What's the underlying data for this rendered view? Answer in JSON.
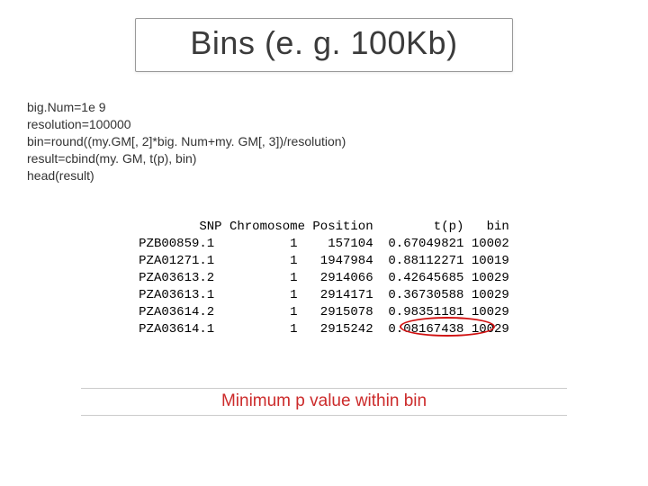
{
  "title": "Bins (e. g. 100Kb)",
  "code": {
    "l1": "big.Num=1e 9",
    "l2": "resolution=100000",
    "l3": "bin=round((my.GM[, 2]*big. Num+my. GM[, 3])/resolution)",
    "l4": "result=cbind(my. GM, t(p), bin)",
    "l5": "head(result)"
  },
  "table": {
    "header": "        SNP Chromosome Position        t(p)   bin",
    "rows": [
      "PZB00859.1          1    157104  0.67049821 10002",
      "PZA01271.1          1   1947984  0.88112271 10019",
      "PZA03613.2          1   2914066  0.42645685 10029",
      "PZA03613.1          1   2914171  0.36730588 10029",
      "PZA03614.2          1   2915078  0.98351181 10029",
      "PZA03614.1          1   2915242  0.08167438 10029"
    ]
  },
  "caption": "Minimum p value within bin"
}
